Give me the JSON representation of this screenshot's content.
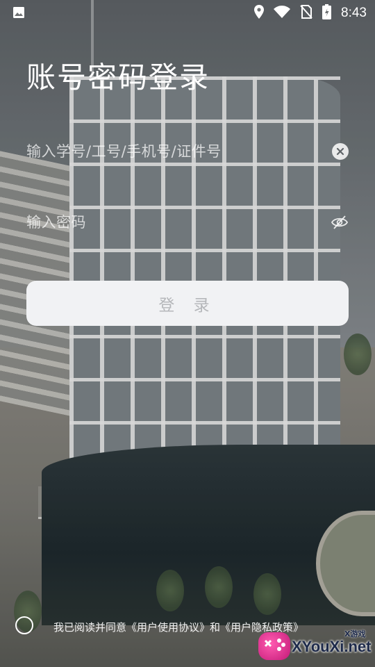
{
  "status_bar": {
    "time": "8:43",
    "icons": [
      "image-icon",
      "location-icon",
      "wifi-icon",
      "no-sim-icon",
      "battery-icon"
    ]
  },
  "login": {
    "title": "账号密码登录",
    "account_placeholder": "输入学号/工号/手机号/证件号",
    "account_value": "",
    "password_placeholder": "输入密码",
    "password_value": "",
    "submit_label": "登 录"
  },
  "agreement": {
    "checked": false,
    "text": "我已阅读并同意《用户使用协议》和《用户隐私政策》"
  },
  "watermark": {
    "brand": "XYouXi.net",
    "sub": "X游戏"
  },
  "colors": {
    "button_bg": "#f1f2f4",
    "button_text": "#b5b7ba",
    "text": "#ffffff"
  }
}
